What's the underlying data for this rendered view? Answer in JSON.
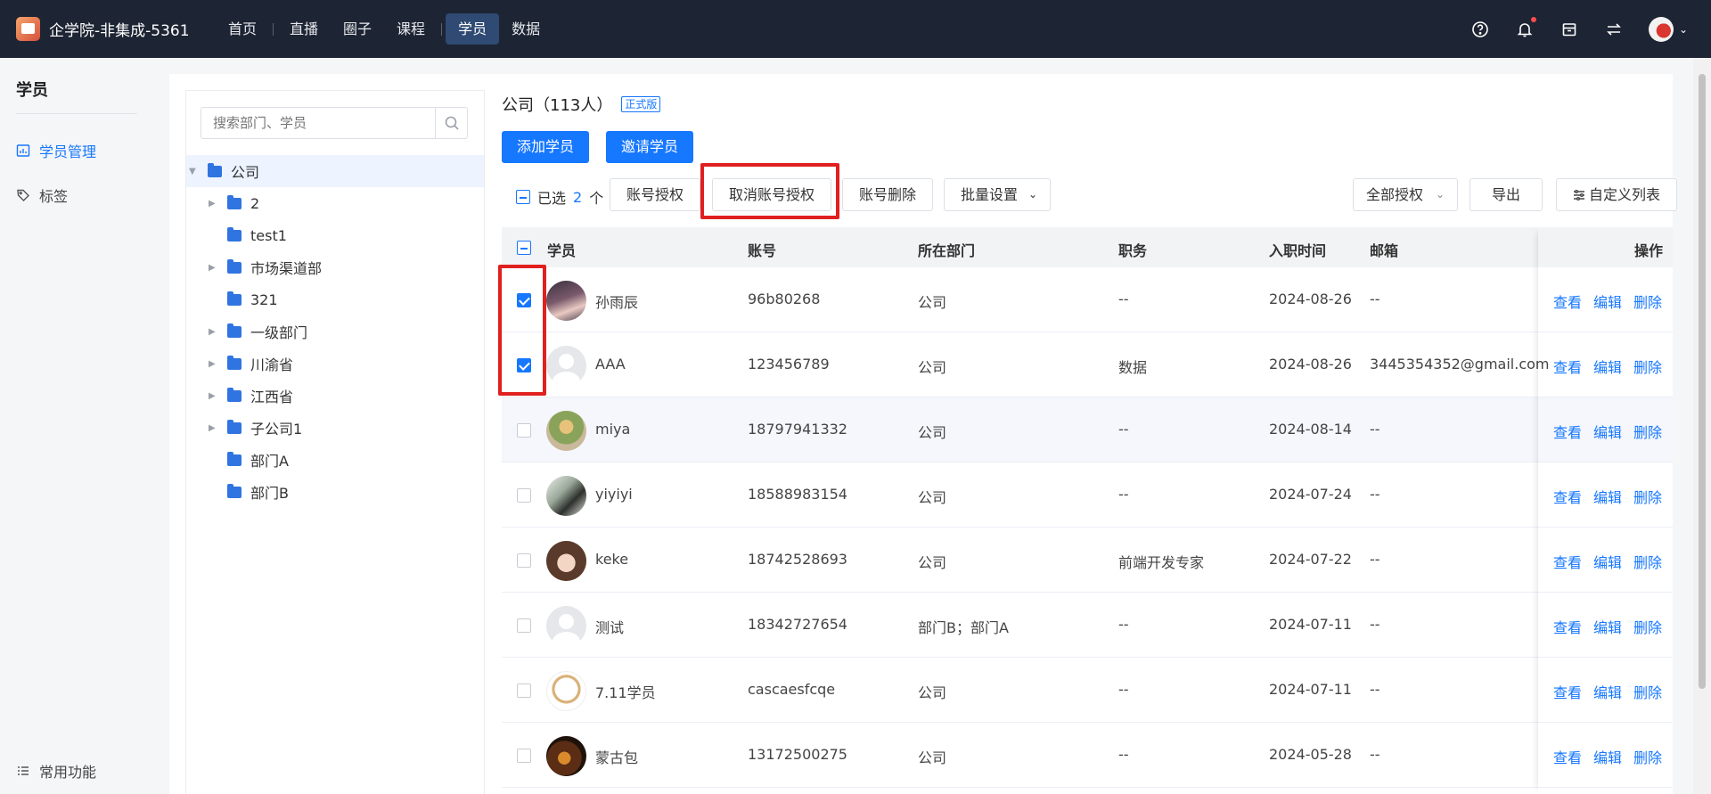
{
  "app": {
    "title": "企学院-非集成-5361"
  },
  "nav": [
    "首页",
    "直播",
    "圈子",
    "课程",
    "学员",
    "数据"
  ],
  "sidebar": {
    "title": "学员",
    "items": [
      {
        "label": "学员管理"
      },
      {
        "label": "标签"
      }
    ],
    "footer": "常用功能"
  },
  "tree": {
    "search_placeholder": "搜索部门、学员",
    "nodes": [
      "公司",
      "2",
      "test1",
      "市场渠道部",
      "321",
      "一级部门",
      "川渝省",
      "江西省",
      "子公司1",
      "部门A",
      "部门B"
    ]
  },
  "header": {
    "title": "公司（113人）",
    "badge": "正式版"
  },
  "actions": {
    "add": "添加学员",
    "invite": "邀请学员"
  },
  "toolbar": {
    "selected_prefix": "已选",
    "selected_count": "2",
    "selected_suffix": "个",
    "grant": "账号授权",
    "revoke": "取消账号授权",
    "delete": "账号删除",
    "batch": "批量设置",
    "filter": "全部授权",
    "export": "导出",
    "custom": "自定义列表"
  },
  "table": {
    "columns": [
      "学员",
      "账号",
      "所在部门",
      "职务",
      "入职时间",
      "邮箱",
      "操作"
    ],
    "row_actions": [
      "查看",
      "编辑",
      "删除"
    ],
    "rows": [
      {
        "name": "孙雨辰",
        "account": "96b80268",
        "dept": "公司",
        "title": "--",
        "date": "2024-08-26",
        "email": "--",
        "checked": true
      },
      {
        "name": "AAA",
        "account": "123456789",
        "dept": "公司",
        "title": "数据",
        "date": "2024-08-26",
        "email": "3445354352@gmail.com",
        "checked": true
      },
      {
        "name": "miya",
        "account": "18797941332",
        "dept": "公司",
        "title": "--",
        "date": "2024-08-14",
        "email": "--",
        "checked": false
      },
      {
        "name": "yiyiyi",
        "account": "18588983154",
        "dept": "公司",
        "title": "--",
        "date": "2024-07-24",
        "email": "--",
        "checked": false
      },
      {
        "name": "keke",
        "account": "18742528693",
        "dept": "公司",
        "title": "前端开发专家",
        "date": "2024-07-22",
        "email": "--",
        "checked": false
      },
      {
        "name": "测试",
        "account": "18342727654",
        "dept": "部门B；部门A",
        "title": "--",
        "date": "2024-07-11",
        "email": "--",
        "checked": false
      },
      {
        "name": "7.11学员",
        "account": "cascaesfcqe",
        "dept": "公司",
        "title": "--",
        "date": "2024-07-11",
        "email": "--",
        "checked": false
      },
      {
        "name": "蒙古包",
        "account": "13172500275",
        "dept": "公司",
        "title": "--",
        "date": "2024-05-28",
        "email": "--",
        "checked": false
      }
    ]
  },
  "colors": {
    "primary": "#1677ff",
    "topbar": "#1d2433",
    "highlight": "#e02020"
  }
}
